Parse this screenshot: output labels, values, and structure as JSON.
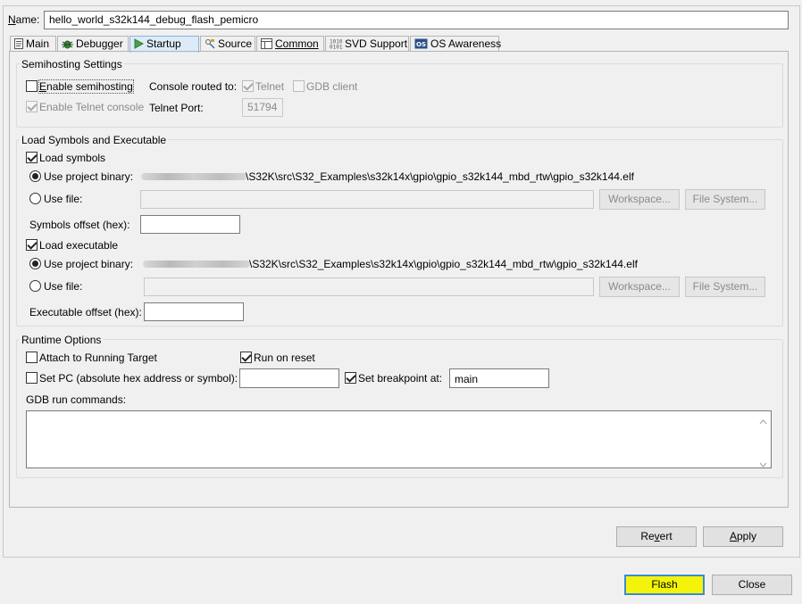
{
  "config": {
    "name_label": "Name:",
    "name_value": "hello_world_s32k144_debug_flash_pemicro"
  },
  "tabs": [
    {
      "label": "Main"
    },
    {
      "label": "Debugger"
    },
    {
      "label": "Startup"
    },
    {
      "label": "Source"
    },
    {
      "label": "Common"
    },
    {
      "label": "SVD Support"
    },
    {
      "label": "OS Awareness"
    }
  ],
  "semihosting": {
    "title": "Semihosting Settings",
    "enable_label": "Enable semihosting",
    "console_routed_label": "Console routed to:",
    "telnet_label": "Telnet",
    "gdb_client_label": "GDB client",
    "enable_telnet_label": "Enable Telnet console",
    "telnet_port_label": "Telnet Port:",
    "telnet_port_value": "51794"
  },
  "load": {
    "title": "Load Symbols and Executable",
    "load_symbols_label": "Load symbols",
    "use_project_binary_label": "Use project binary:",
    "symbols_binary_path": "\\S32K\\src\\S32_Examples\\s32k14x\\gpio\\gpio_s32k144_mbd_rtw\\gpio_s32k144.elf",
    "use_file_label": "Use file:",
    "workspace_label": "Workspace...",
    "file_system_label": "File System...",
    "symbols_offset_label": "Symbols offset (hex):",
    "symbols_offset_value": "",
    "load_executable_label": "Load executable",
    "exec_binary_path": "\\S32K\\src\\S32_Examples\\s32k14x\\gpio\\gpio_s32k144_mbd_rtw\\gpio_s32k144.elf",
    "executable_offset_label": "Executable offset (hex):",
    "executable_offset_value": ""
  },
  "runtime": {
    "title": "Runtime Options",
    "attach_label": "Attach to Running Target",
    "run_on_reset_label": "Run on reset",
    "set_pc_label": "Set PC (absolute hex address or symbol):",
    "set_pc_value": "",
    "set_breakpoint_label": "Set breakpoint at:",
    "breakpoint_value": "main",
    "gdb_commands_label": "GDB run commands:",
    "gdb_commands_value": ""
  },
  "buttons": {
    "revert": "Revert",
    "apply": "Apply",
    "flash": "Flash",
    "close": "Close"
  },
  "colors": {
    "highlight": "#f4f40a",
    "active_tab": "#dcebf7"
  }
}
